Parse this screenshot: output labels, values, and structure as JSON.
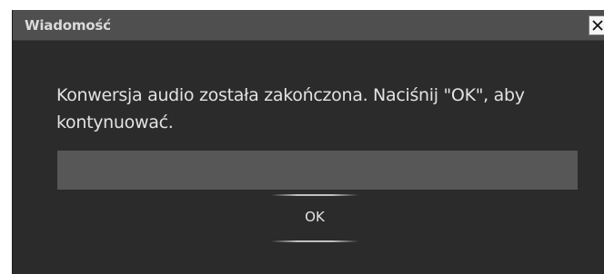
{
  "dialog": {
    "title": "Wiadomość",
    "close_icon": "close-icon",
    "message": "Konwersja audio została zakończona. Naciśnij \"OK\", aby kontynuować.",
    "progress": 0,
    "ok_label": "OK"
  },
  "colors": {
    "background": "#2b2b2b",
    "titlebar": "#4f4f4f",
    "progress_track": "#575757",
    "text": "#e2e2e2"
  }
}
